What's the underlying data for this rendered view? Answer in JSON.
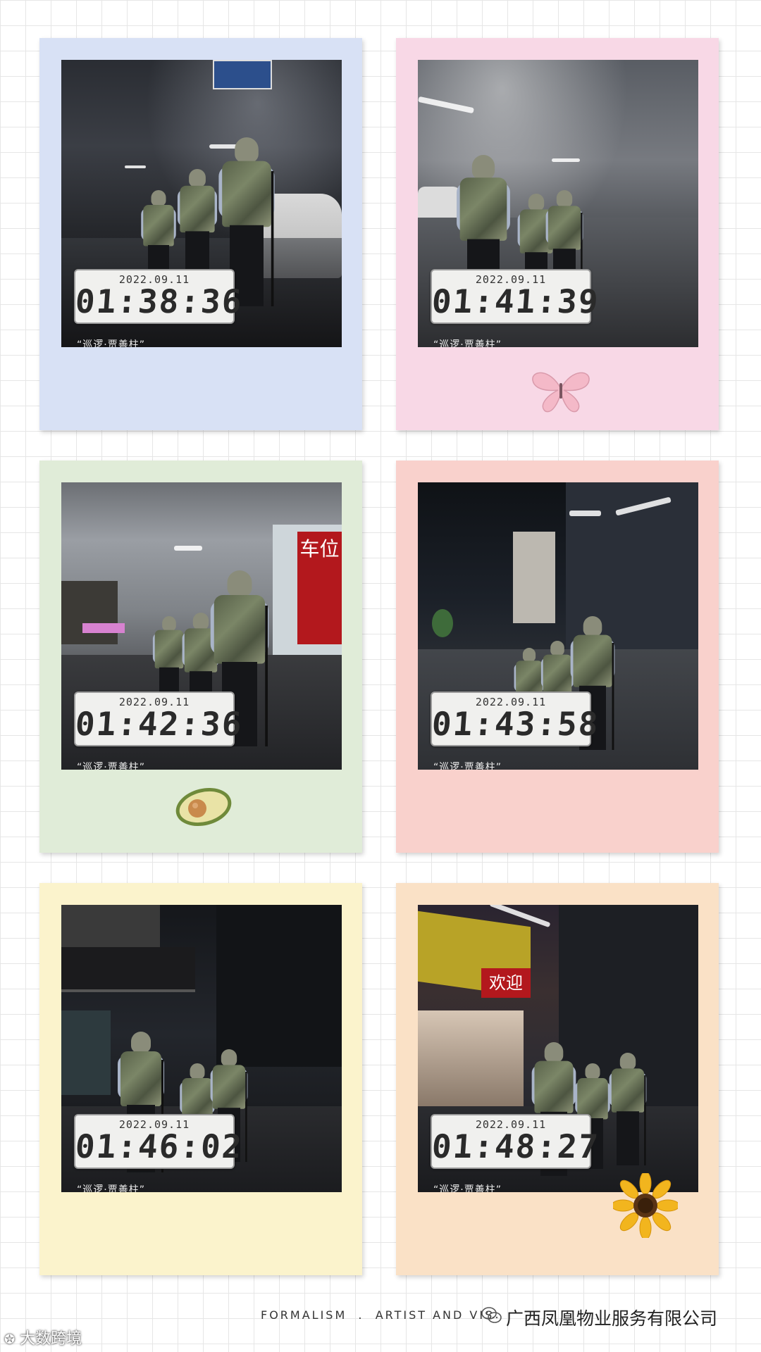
{
  "cards": [
    {
      "bg": "#d8e1f5",
      "date": "2022.09.11",
      "time": "01:38:36",
      "caption": "“巡逻·贾善柱”",
      "scene": "sc-garage-dark"
    },
    {
      "bg": "#f8d8e6",
      "date": "2022.09.11",
      "time": "01:41:39",
      "caption": "“巡逻·贾善柱”",
      "scene": "sc-garage-lit",
      "sticker": "butterfly"
    },
    {
      "bg": "#e0ecd8",
      "date": "2022.09.11",
      "time": "01:42:36",
      "caption": "“巡逻·贾善柱”",
      "scene": "sc-ramp",
      "sticker": "avocado",
      "sign_text": "车位"
    },
    {
      "bg": "#f9d1cc",
      "date": "2022.09.11",
      "time": "01:43:58",
      "caption": "“巡逻·贾善柱”",
      "scene": "sc-night"
    },
    {
      "bg": "#fbf3cc",
      "date": "2022.09.11",
      "time": "01:46:02",
      "caption": "“巡逻·贾善柱”",
      "scene": "sc-street"
    },
    {
      "bg": "#fae1c6",
      "date": "2022.09.11",
      "time": "01:48:27",
      "caption": "“巡逻·贾善柱”",
      "scene": "sc-shop",
      "sticker": "sunflower",
      "sign_text": "欢迎"
    }
  ],
  "footer": {
    "text": "FORMALISM  .  ARTIST AND VIS",
    "company": "广西凤凰物业服务有限公司",
    "watermark": "大数跨境"
  },
  "icons": [
    "butterfly-sticker-icon",
    "avocado-sticker-icon",
    "sunflower-sticker-icon",
    "wechat-icon"
  ]
}
